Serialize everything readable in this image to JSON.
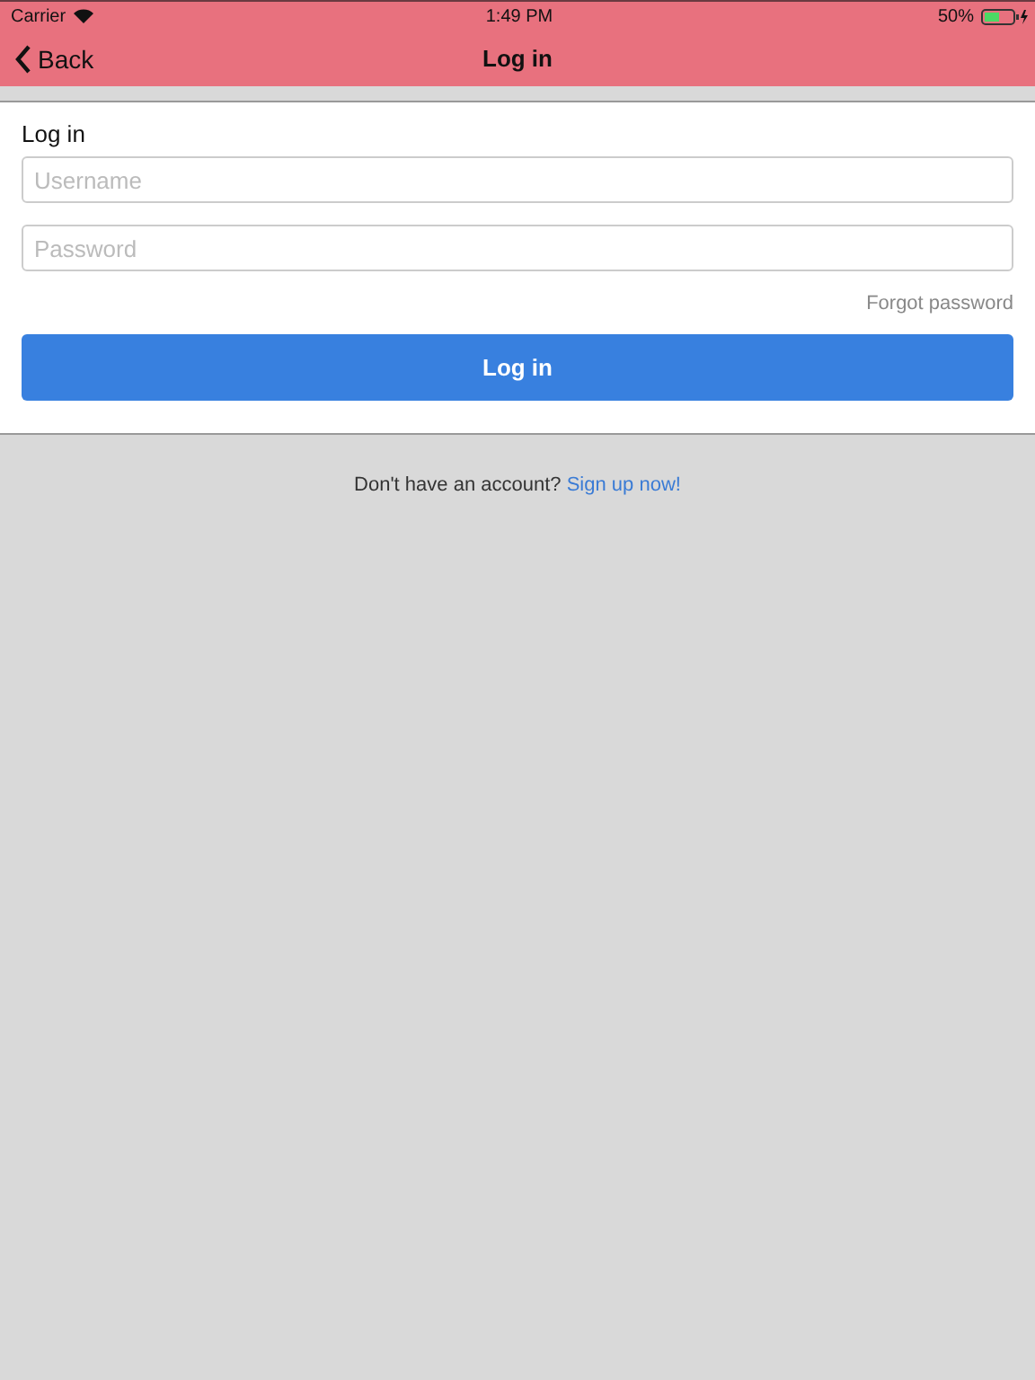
{
  "status_bar": {
    "carrier": "Carrier",
    "time": "1:49 PM",
    "battery": "50%"
  },
  "nav_bar": {
    "back": "Back",
    "title": "Log in"
  },
  "form": {
    "heading": "Log in",
    "fields": [
      {
        "placeholder": "Username"
      },
      {
        "placeholder": "Password"
      }
    ],
    "forgot_link": "Forgot password",
    "submit": "Log in"
  },
  "footer": {
    "prompt": "Don't have an account?",
    "link": "Sign up now!"
  }
}
